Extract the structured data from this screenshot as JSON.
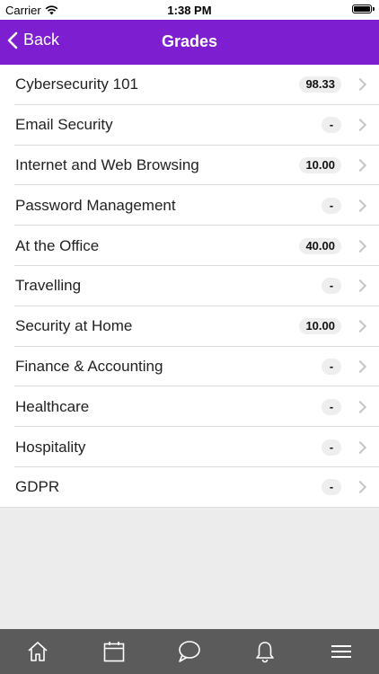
{
  "status_bar": {
    "carrier": "Carrier",
    "time": "1:38 PM",
    "icons": [
      "wifi-icon",
      "battery-icon"
    ]
  },
  "nav": {
    "back_label": "Back",
    "title": "Grades",
    "background_color": "#7d1fd0"
  },
  "grades": {
    "items": [
      {
        "course": "Cybersecurity 101",
        "grade": "98.33"
      },
      {
        "course": "Email Security",
        "grade": "-"
      },
      {
        "course": "Internet and Web Browsing",
        "grade": "10.00"
      },
      {
        "course": "Password Management",
        "grade": "-"
      },
      {
        "course": "At the Office",
        "grade": "40.00"
      },
      {
        "course": "Travelling",
        "grade": "-"
      },
      {
        "course": "Security at Home",
        "grade": "10.00"
      },
      {
        "course": "Finance & Accounting",
        "grade": "-"
      },
      {
        "course": "Healthcare",
        "grade": "-"
      },
      {
        "course": "Hospitality",
        "grade": "-"
      },
      {
        "course": "GDPR",
        "grade": "-"
      }
    ]
  },
  "tab_bar": {
    "background_color": "#5b5b5b",
    "tabs": [
      "home-icon",
      "calendar-icon",
      "chat-icon",
      "bell-icon",
      "menu-icon"
    ]
  }
}
